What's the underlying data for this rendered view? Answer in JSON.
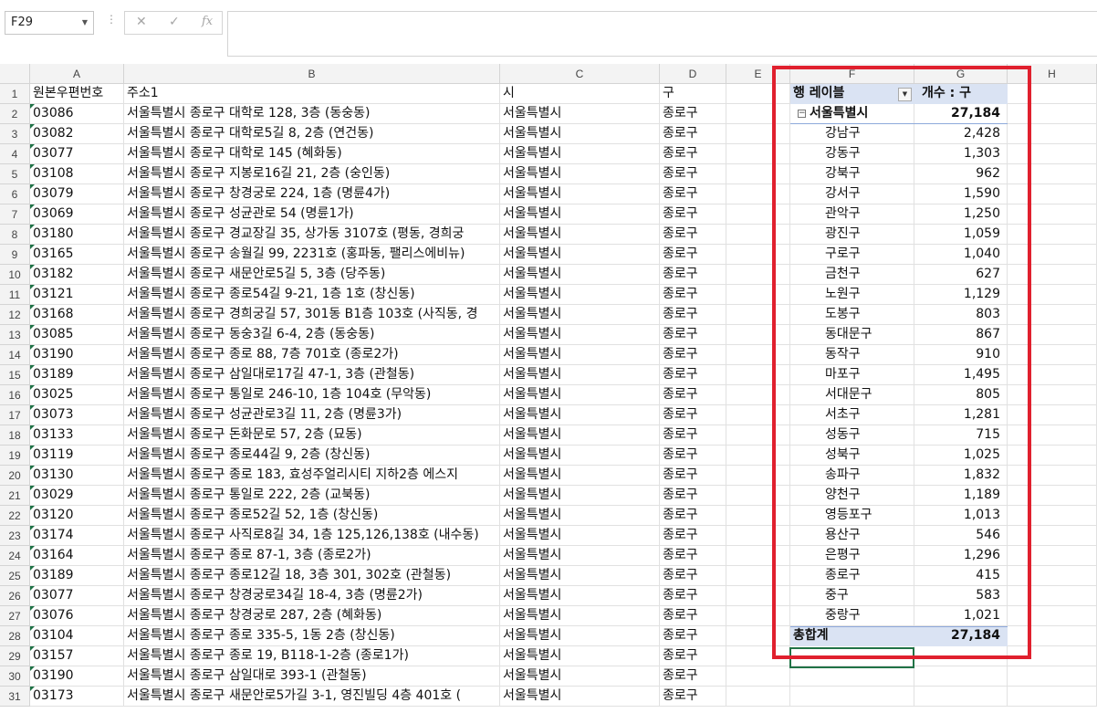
{
  "formula_bar": {
    "name_box": "F29",
    "cancel_icon": "✕",
    "enter_icon": "✓",
    "fx_label": "fx",
    "formula": ""
  },
  "columns": [
    "A",
    "B",
    "C",
    "D",
    "E",
    "F",
    "G",
    "H"
  ],
  "rows": [
    [
      "원본우편번호",
      "주소1",
      "시",
      "구"
    ],
    [
      "03086",
      "서울특별시 종로구 대학로 128, 3층 (동숭동)",
      "서울특별시",
      "종로구"
    ],
    [
      "03082",
      "서울특별시 종로구 대학로5길 8, 2층 (연건동)",
      "서울특별시",
      "종로구"
    ],
    [
      "03077",
      "서울특별시 종로구 대학로 145 (혜화동)",
      "서울특별시",
      "종로구"
    ],
    [
      "03108",
      "서울특별시 종로구 지봉로16길 21, 2층 (숭인동)",
      "서울특별시",
      "종로구"
    ],
    [
      "03079",
      "서울특별시 종로구 창경궁로 224, 1층 (명륜4가)",
      "서울특별시",
      "종로구"
    ],
    [
      "03069",
      "서울특별시 종로구 성균관로 54 (명륜1가)",
      "서울특별시",
      "종로구"
    ],
    [
      "03180",
      "서울특별시 종로구 경교장길 35, 상가동 3107호 (평동, 경희궁",
      "서울특별시",
      "종로구"
    ],
    [
      "03165",
      "서울특별시 종로구 송월길 99, 2231호 (홍파동, 팰리스에비뉴)",
      "서울특별시",
      "종로구"
    ],
    [
      "03182",
      "서울특별시 종로구 새문안로5길 5, 3층 (당주동)",
      "서울특별시",
      "종로구"
    ],
    [
      "03121",
      "서울특별시 종로구 종로54길 9-21, 1층 1호 (창신동)",
      "서울특별시",
      "종로구"
    ],
    [
      "03168",
      "서울특별시 종로구 경희궁길 57, 301동 B1층 103호 (사직동, 경",
      "서울특별시",
      "종로구"
    ],
    [
      "03085",
      "서울특별시 종로구 동숭3길 6-4, 2층 (동숭동)",
      "서울특별시",
      "종로구"
    ],
    [
      "03190",
      "서울특별시 종로구 종로 88, 7층 701호 (종로2가)",
      "서울특별시",
      "종로구"
    ],
    [
      "03189",
      "서울특별시 종로구 삼일대로17길 47-1, 3층 (관철동)",
      "서울특별시",
      "종로구"
    ],
    [
      "03025",
      "서울특별시 종로구 통일로 246-10, 1층 104호 (무악동)",
      "서울특별시",
      "종로구"
    ],
    [
      "03073",
      "서울특별시 종로구 성균관로3길 11, 2층 (명륜3가)",
      "서울특별시",
      "종로구"
    ],
    [
      "03133",
      "서울특별시 종로구 돈화문로 57, 2층 (묘동)",
      "서울특별시",
      "종로구"
    ],
    [
      "03119",
      "서울특별시 종로구 종로44길 9, 2층 (창신동)",
      "서울특별시",
      "종로구"
    ],
    [
      "03130",
      "서울특별시 종로구 종로 183, 효성주얼리시티 지하2층 에스지",
      "서울특별시",
      "종로구"
    ],
    [
      "03029",
      "서울특별시 종로구 통일로 222, 2층 (교북동)",
      "서울특별시",
      "종로구"
    ],
    [
      "03120",
      "서울특별시 종로구 종로52길 52, 1층 (창신동)",
      "서울특별시",
      "종로구"
    ],
    [
      "03174",
      "서울특별시 종로구 사직로8길 34, 1층 125,126,138호 (내수동)",
      "서울특별시",
      "종로구"
    ],
    [
      "03164",
      "서울특별시 종로구 종로 87-1, 3층 (종로2가)",
      "서울특별시",
      "종로구"
    ],
    [
      "03189",
      "서울특별시 종로구 종로12길 18, 3층 301, 302호 (관철동)",
      "서울특별시",
      "종로구"
    ],
    [
      "03077",
      "서울특별시 종로구 창경궁로34길 18-4, 3층 (명륜2가)",
      "서울특별시",
      "종로구"
    ],
    [
      "03076",
      "서울특별시 종로구 창경궁로 287, 2층 (혜화동)",
      "서울특별시",
      "종로구"
    ],
    [
      "03104",
      "서울특별시 종로구 종로 335-5, 1동 2층 (창신동)",
      "서울특별시",
      "종로구"
    ],
    [
      "03157",
      "서울특별시 종로구 종로 19, B118-1-2층 (종로1가)",
      "서울특별시",
      "종로구"
    ],
    [
      "03190",
      "서울특별시 종로구 삼일대로 393-1 (관철동)",
      "서울특별시",
      "종로구"
    ],
    [
      "03173",
      "서울특별시 종로구 새문안로5가길 3-1, 영진빌딩 4층 401호 (",
      "서울특별시",
      "종로구"
    ]
  ],
  "pivot": {
    "row_label_header": "행 레이블",
    "value_header": "개수 : 구",
    "filter_icon": "▼",
    "collapse_icon": "−",
    "city": "서울특별시",
    "city_total": "27,184",
    "districts": [
      [
        "강남구",
        "2,428"
      ],
      [
        "강동구",
        "1,303"
      ],
      [
        "강북구",
        "962"
      ],
      [
        "강서구",
        "1,590"
      ],
      [
        "관악구",
        "1,250"
      ],
      [
        "광진구",
        "1,059"
      ],
      [
        "구로구",
        "1,040"
      ],
      [
        "금천구",
        "627"
      ],
      [
        "노원구",
        "1,129"
      ],
      [
        "도봉구",
        "803"
      ],
      [
        "동대문구",
        "867"
      ],
      [
        "동작구",
        "910"
      ],
      [
        "마포구",
        "1,495"
      ],
      [
        "서대문구",
        "805"
      ],
      [
        "서초구",
        "1,281"
      ],
      [
        "성동구",
        "715"
      ],
      [
        "성북구",
        "1,025"
      ],
      [
        "송파구",
        "1,832"
      ],
      [
        "양천구",
        "1,189"
      ],
      [
        "영등포구",
        "1,013"
      ],
      [
        "용산구",
        "546"
      ],
      [
        "은평구",
        "1,296"
      ],
      [
        "종로구",
        "415"
      ],
      [
        "중구",
        "583"
      ],
      [
        "중랑구",
        "1,021"
      ]
    ],
    "grand_total_label": "총합계",
    "grand_total": "27,184"
  }
}
